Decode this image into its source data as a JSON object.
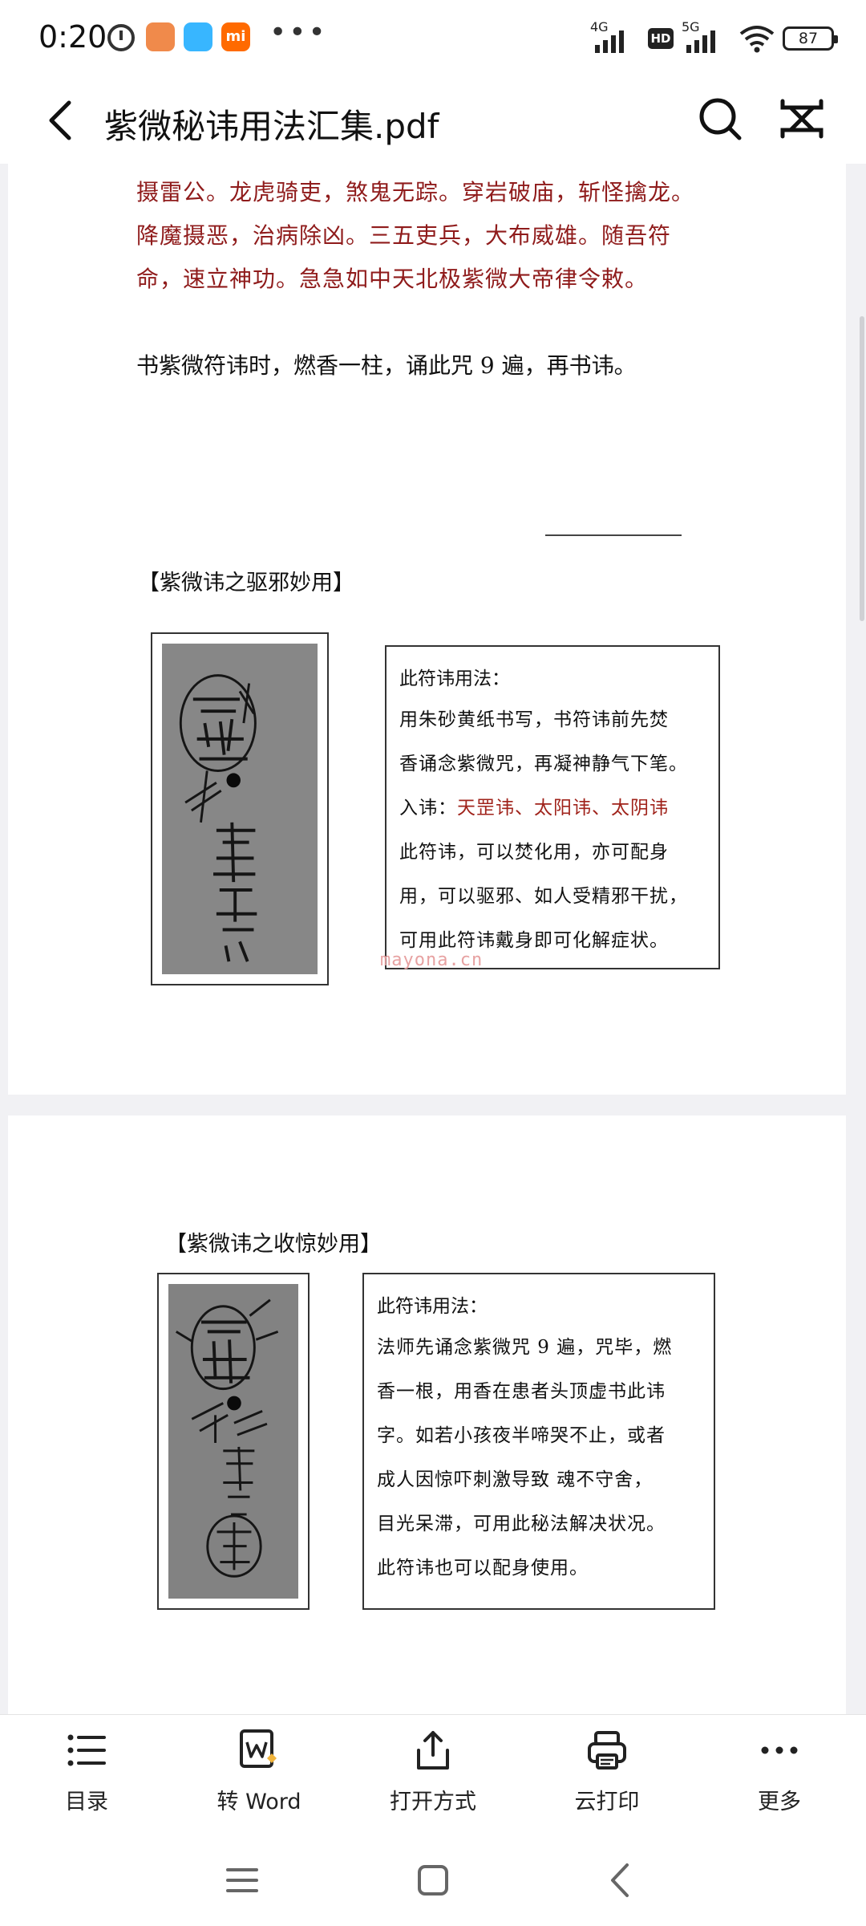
{
  "status_bar": {
    "time": "0:20",
    "app_icon_mi": "mi",
    "signal1_label": "4G",
    "hd_label": "HD",
    "signal2_label": "5G",
    "battery": "87"
  },
  "app_bar": {
    "title": "紫微秘讳用法汇集.pdf"
  },
  "page1": {
    "red_lines": [
      "摄雷公。龙虎骑吏，煞鬼无踪。穿岩破庙，斩怪擒龙。",
      "降魔摄恶，治病除凶。三五吏兵，大布威雄。随吾符",
      "命，速立神功。急急如中天北极紫微大帝律令敕。"
    ],
    "instruction": "书紫微符讳时，燃香一柱，诵此咒 9 遍，再书讳。",
    "section_heading": "【紫微讳之驱邪妙用】",
    "usage": {
      "title": "此符讳用法：",
      "line1": "用朱砂黄纸书写，书符讳前先焚",
      "line2": "香诵念紫微咒，再凝神静气下笔。",
      "line3_prefix": "入讳：",
      "line3_red": "天罡讳、太阳讳、太阴讳",
      "line4": "此符讳，可以焚化用，亦可配身",
      "line5": "用，可以驱邪、如人受精邪干扰，",
      "line6": "可用此符讳戴身即可化解症状。"
    },
    "watermark": "mayona.cn"
  },
  "page2": {
    "section_heading": "【紫微讳之收惊妙用】",
    "usage": {
      "title": "此符讳用法：",
      "line1": "法师先诵念紫微咒 9 遍，咒毕，燃",
      "line2": "香一根，用香在患者头顶虚书此讳",
      "line3": "字。如若小孩夜半啼哭不止，或者",
      "line4": "成人因惊吓刺激导致 魂不守舍，",
      "line5": "目光呆滞，可用此秘法解决状况。",
      "line6": "此符讳也可以配身使用。"
    }
  },
  "toolbar": {
    "items": [
      {
        "label": "目录",
        "icon": "list-icon"
      },
      {
        "label": "转 Word",
        "icon": "word-convert-icon"
      },
      {
        "label": "打开方式",
        "icon": "share-icon"
      },
      {
        "label": "云打印",
        "icon": "printer-icon"
      },
      {
        "label": "更多",
        "icon": "more-icon"
      }
    ]
  },
  "colors": {
    "scripture_red": "#8f1b1b",
    "highlight_red": "#a0231b",
    "viewport_bg": "#f1f1f4"
  }
}
